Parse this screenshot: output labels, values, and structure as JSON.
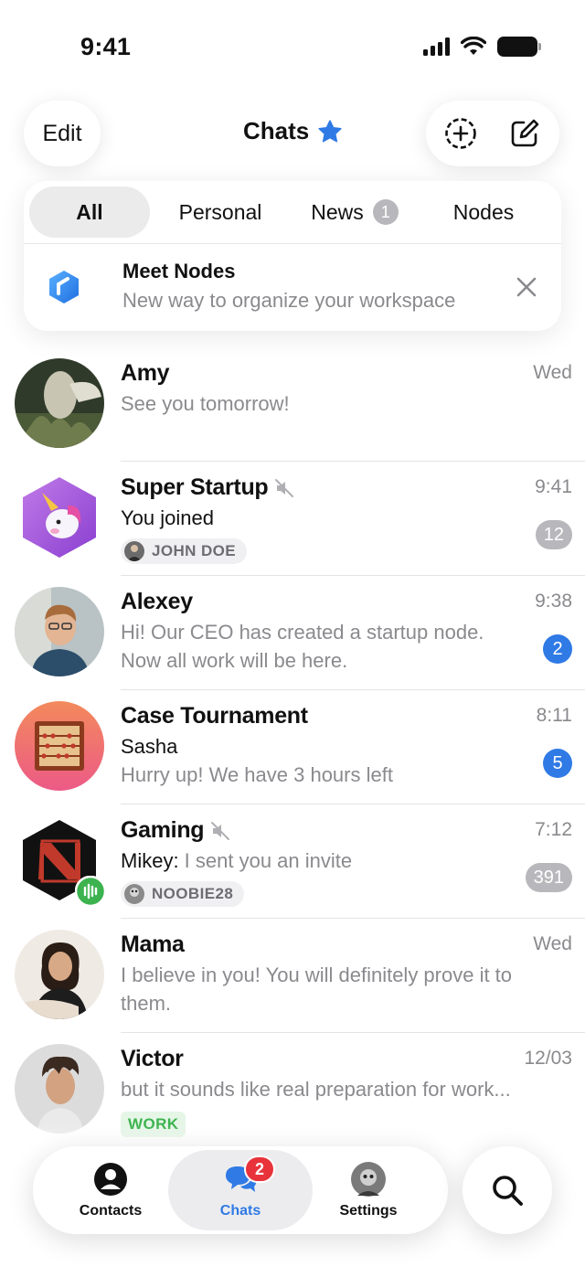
{
  "status_bar": {
    "time": "9:41"
  },
  "header": {
    "edit_label": "Edit",
    "title": "Chats",
    "star_color": "#2f7ae5"
  },
  "folders": {
    "tabs": [
      {
        "label": "All",
        "active": true
      },
      {
        "label": "Personal"
      },
      {
        "label": "News",
        "badge": "1"
      },
      {
        "label": "Nodes"
      }
    ]
  },
  "promo": {
    "title": "Meet Nodes",
    "subtitle": "New way to organize your workspace",
    "icon": "nodes-logo-icon"
  },
  "chats": [
    {
      "name": "Amy",
      "time": "Wed",
      "line1": "See you tomorrow!"
    },
    {
      "name": "Super Startup",
      "muted": true,
      "time": "9:41",
      "line1": "You joined",
      "chip": "JOHN DOE",
      "unread": "12"
    },
    {
      "name": "Alexey",
      "time": "9:38",
      "line1": "Hi! Our CEO has created a startup node.",
      "line2": "Now all work will be here.",
      "unread": "2"
    },
    {
      "name": "Case Tournament",
      "time": "8:11",
      "line1": "Sasha",
      "line2": "Hurry up! We have 3 hours left",
      "unread": "5"
    },
    {
      "name": "Gaming",
      "muted": true,
      "time": "7:12",
      "sender": "Mikey:",
      "line1": " I sent you an invite",
      "chip": "NOOBIE28",
      "unread": "391"
    },
    {
      "name": "Mama",
      "time": "Wed",
      "line1": "I believe in you! You will definitely prove it to",
      "line2": "them."
    },
    {
      "name": "Victor",
      "time": "12/03",
      "line1": "but it sounds like real preparation for work...",
      "tag": "WORK"
    }
  ],
  "tabbar": {
    "contacts": "Contacts",
    "chats": "Chats",
    "chats_badge": "2",
    "settings": "Settings"
  },
  "colors": {
    "accent": "#2f7ae5",
    "badge_red": "#e8333b",
    "muted_badge": "#b8b8bc",
    "work_tag": "#3cb34f"
  }
}
